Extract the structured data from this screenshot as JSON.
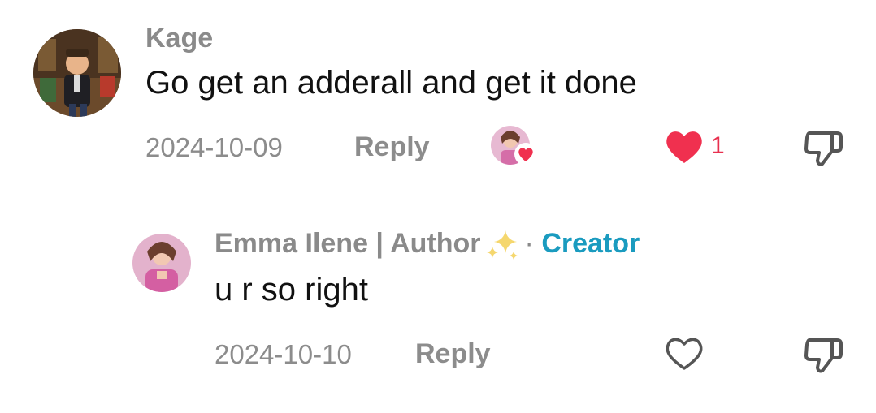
{
  "comment": {
    "username": "Kage",
    "text": "Go get an adderall and get it done",
    "date": "2024-10-09",
    "reply_label": "Reply",
    "like_count": "1",
    "liked": true,
    "liked_by_creator": true
  },
  "reply": {
    "username": "Emma Ilene | Author",
    "separator": "·",
    "creator_label": "Creator",
    "text": "u r so right",
    "date": "2024-10-10",
    "reply_label": "Reply",
    "liked": false
  },
  "icons": {
    "heart_filled": "heart-filled-icon",
    "heart_outline": "heart-outline-icon",
    "dislike": "thumbs-down-icon",
    "sparkles": "sparkles-icon"
  },
  "colors": {
    "heart": "#f0304f",
    "creator": "#1a9bbf",
    "muted": "#8c8c8c"
  }
}
